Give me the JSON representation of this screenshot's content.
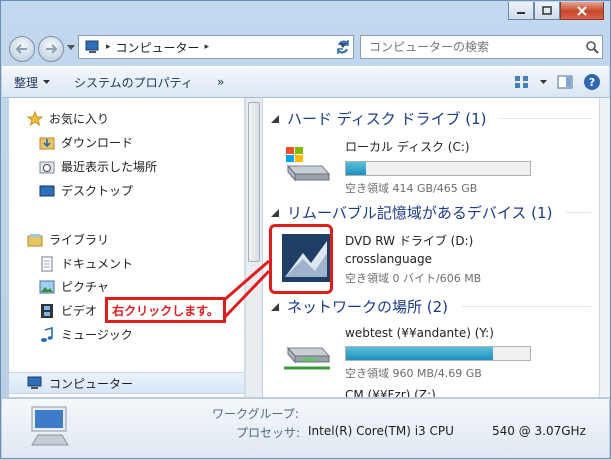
{
  "window": {
    "minimize": "minimize",
    "maximize": "maximize",
    "close": "close"
  },
  "address": {
    "crumb": "コンピューター",
    "search_placeholder": "コンピューターの検索"
  },
  "toolbar": {
    "organize": "整理",
    "system_properties": "システムのプロパティ",
    "more": "»"
  },
  "nav": {
    "favorites": "お気に入り",
    "downloads": "ダウンロード",
    "recent": "最近表示した場所",
    "desktop": "デスクトップ",
    "libraries": "ライブラリ",
    "documents": "ドキュメント",
    "pictures": "ピクチャ",
    "videos": "ビデオ",
    "music": "ミュージック",
    "computer": "コンピューター"
  },
  "content": {
    "hdd_group": "ハード ディスク ドライブ (1)",
    "hdd_name": "ローカル ディスク (C:)",
    "hdd_free": "空き領域 414 GB/465 GB",
    "hdd_fill": 0.11,
    "removable_group": "リムーバブル記憶域があるデバイス (1)",
    "dvd_name": "DVD RW ドライブ (D:)",
    "dvd_label": "crosslanguage",
    "dvd_free": "空き領域 0 バイト/606 MB",
    "network_group": "ネットワークの場所 (2)",
    "net1_name": "webtest (¥¥andante) (Y:)",
    "net1_free": "空き領域 960 MB/4.69 GB",
    "net1_fill": 0.8,
    "net2_name": "CM (¥¥Fzr) (Z:)"
  },
  "annotation": {
    "label": "右クリックします。"
  },
  "details": {
    "workgroup_label": "ワークグループ:",
    "processor_label": "プロセッサ:",
    "processor_value": "Intel(R) Core(TM) i3 CPU",
    "processor_speed": "540  @ 3.07GHz"
  }
}
